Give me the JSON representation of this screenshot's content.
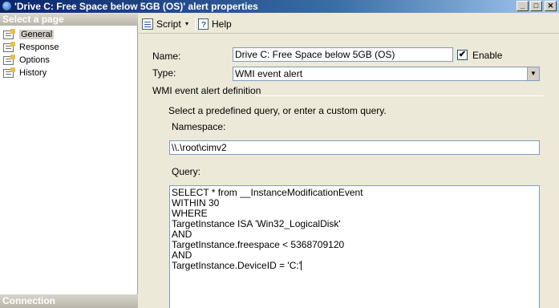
{
  "window": {
    "title": "'Drive C: Free Space below 5GB (OS)' alert properties",
    "controls": {
      "minimize": "_",
      "maximize": "□",
      "close": "✕"
    }
  },
  "sidebar": {
    "header": "Select a page",
    "items": [
      {
        "label": "General",
        "selected": true
      },
      {
        "label": "Response",
        "selected": false
      },
      {
        "label": "Options",
        "selected": false
      },
      {
        "label": "History",
        "selected": false
      }
    ],
    "footer": "Connection"
  },
  "toolbar": {
    "script_label": "Script",
    "script_arrow": "▾",
    "help_label": "Help"
  },
  "form": {
    "name_label": "Name:",
    "name_value": "Drive C: Free Space below 5GB (OS)",
    "enable_label": "Enable",
    "enable_checked": true,
    "enable_mark": "✔",
    "type_label": "Type:",
    "type_value": "WMI event alert",
    "type_arrow": "▼",
    "section_label": "WMI event alert definition",
    "instructions": "Select a predefined query, or enter a custom query.",
    "namespace_label": "Namespace:",
    "namespace_value": "\\\\.\\root\\cimv2",
    "query_label": "Query:",
    "query_lines": [
      "SELECT * from __InstanceModificationEvent",
      "WITHIN 30",
      "WHERE",
      "TargetInstance ISA 'Win32_LogicalDisk'",
      "AND",
      "TargetInstance.freespace < 5368709120",
      "AND",
      "TargetInstance.DeviceID = 'C:'"
    ]
  }
}
